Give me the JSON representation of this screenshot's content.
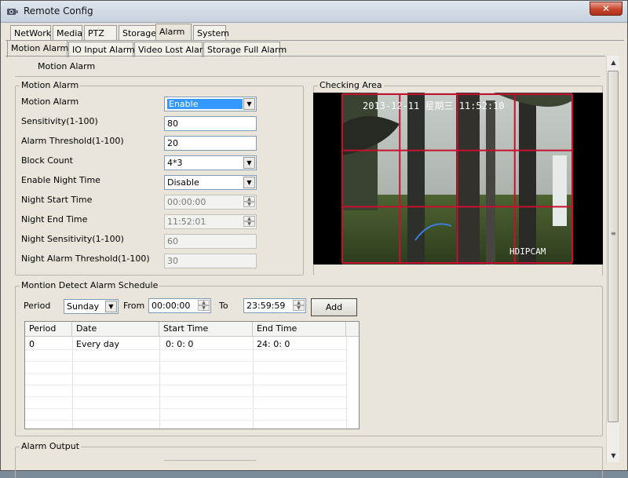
{
  "window": {
    "title": "Remote Config",
    "close_label": "✕"
  },
  "main_tabs": [
    "NetWork",
    "Media",
    "PTZ",
    "Storage",
    "Alarm",
    "System"
  ],
  "sub_tabs": [
    "Motion Alarm",
    "IO Input Alarm",
    "Video Lost Alarm",
    "Storage Full Alarm"
  ],
  "section_heading": "Motion Alarm",
  "motion_group": {
    "legend": "Motion Alarm",
    "fields": [
      {
        "label": "Motion Alarm",
        "value": "Enable"
      },
      {
        "label": "Sensitivity(1-100)",
        "value": "80"
      },
      {
        "label": "Alarm Threshold(1-100)",
        "value": "20"
      },
      {
        "label": "Block Count",
        "value": "4*3"
      },
      {
        "label": "Enable Night Time",
        "value": "Disable"
      },
      {
        "label": "Night Start Time",
        "value": "00:00:00"
      },
      {
        "label": "Night End Time",
        "value": "11:52:01"
      },
      {
        "label": "Night Sensitivity(1-100)",
        "value": "60"
      },
      {
        "label": "Night Alarm Threshold(1-100)",
        "value": "30"
      }
    ]
  },
  "checking_area": {
    "legend": "Checking Area",
    "osd_timestamp": "2013-12-11 星期三 11:52:10",
    "osd_name": "HDIPCAM",
    "grid_color": "#c8102e"
  },
  "schedule": {
    "legend": "Montion Detect Alarm Schedule",
    "period_label": "Period",
    "period_value": "Sunday",
    "from_label": "From",
    "from_value": "00:00:00",
    "to_label": "To",
    "to_value": "23:59:59",
    "add_label": "Add",
    "columns": [
      "Period",
      "Date",
      "Start Time",
      "End Time"
    ],
    "rows": [
      [
        "0",
        "Every day",
        "0: 0: 0",
        "24: 0: 0"
      ]
    ]
  },
  "alarm_output": {
    "legend": "Alarm Output"
  },
  "colors": {
    "selection": "#3399ff",
    "window_bg": "#e9e5da"
  }
}
